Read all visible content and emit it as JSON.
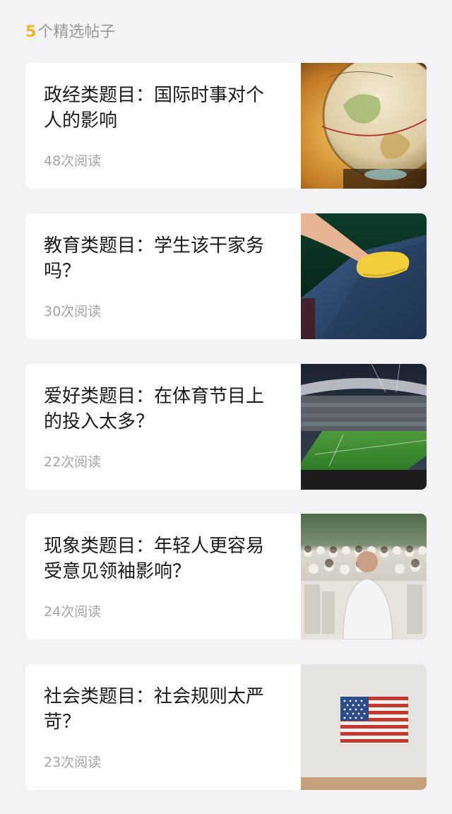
{
  "header": {
    "count": "5",
    "label": "个精选帖子"
  },
  "posts": [
    {
      "title": "政经类题目：国际时事对个人的影响",
      "reads": "48次阅读",
      "image": "globe"
    },
    {
      "title": "教育类题目：学生该干家务吗？",
      "reads": "30次阅读",
      "image": "hand-cleaning-with-sponge"
    },
    {
      "title": "爱好类题目：在体育节目上的投入太多？",
      "reads": "22次阅读",
      "image": "football-stadium"
    },
    {
      "title": "现象类题目：年轻人更容易受意见领袖影响？",
      "reads": "24次阅读",
      "image": "speaker-addressing-crowd"
    },
    {
      "title": "社会类题目：社会规则太严苛？",
      "reads": "23次阅读",
      "image": "flag-painting-on-wall"
    }
  ],
  "colors": {
    "background": "#f3f3f5",
    "card": "#ffffff",
    "count_accent": "#f0b323",
    "title_text": "#1a1a1a",
    "meta_text": "#a4a4a4"
  }
}
